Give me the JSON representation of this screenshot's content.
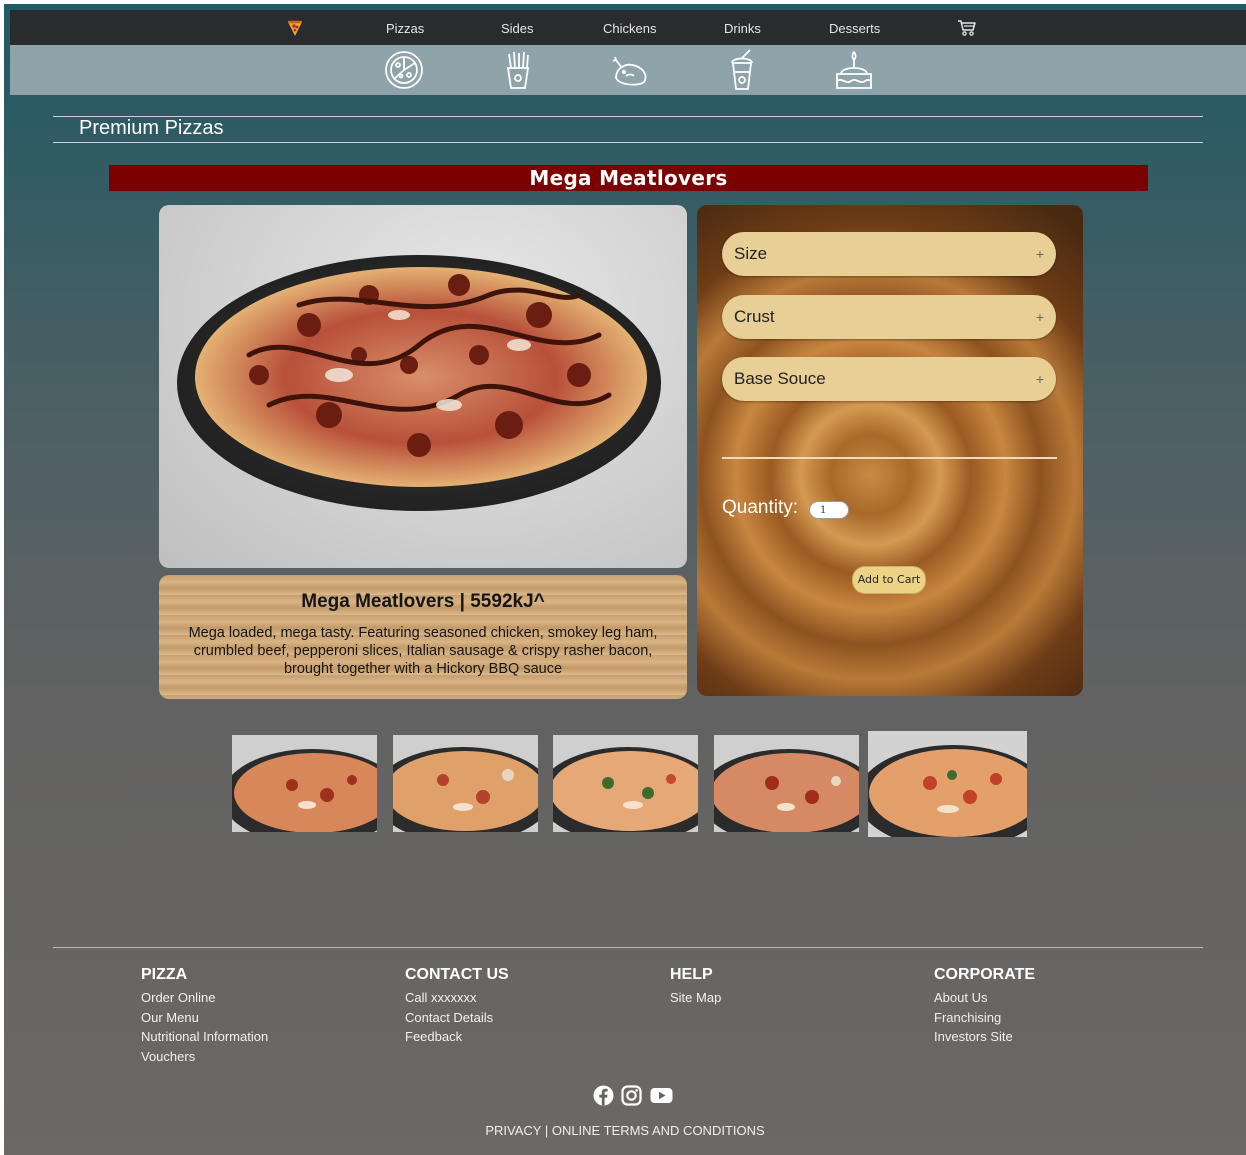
{
  "nav": {
    "items": [
      "Pizzas",
      "Sides",
      "Chickens",
      "Drinks",
      "Desserts"
    ],
    "logo_icon": "pizza-slice-icon",
    "cart_icon": "cart-icon"
  },
  "category_icons": [
    "pizza-icon",
    "fries-icon",
    "chicken-icon",
    "drink-icon",
    "cake-icon"
  ],
  "page": {
    "title": "Premium Pizzas"
  },
  "product": {
    "banner": "Mega Meatlovers",
    "title": "Mega Meatlovers | 5592kJ^",
    "description": "Mega loaded, mega tasty. Featuring seasoned chicken, smokey leg ham, crumbled beef, pepperoni slices, Italian sausage & crispy rasher bacon, brought together with a Hickory BBQ sauce"
  },
  "options": {
    "accordions": [
      "Size",
      "Crust",
      "Base Souce"
    ],
    "quantity_label": "Quantity:",
    "quantity_value": "1",
    "add_to_cart": "Add to Cart"
  },
  "thumbnails": {
    "count": 5,
    "selected_index": 4
  },
  "footer": {
    "columns": [
      {
        "heading": "PIZZA",
        "links": [
          "Order Online",
          "Our Menu",
          "Nutritional Information",
          "Vouchers"
        ]
      },
      {
        "heading": "CONTACT US",
        "links": [
          "Call xxxxxxx",
          "Contact Details",
          "Feedback"
        ]
      },
      {
        "heading": "HELP",
        "links": [
          "Site Map"
        ]
      },
      {
        "heading": "CORPORATE",
        "links": [
          "About Us",
          "Franchising",
          "Investors Site"
        ]
      }
    ],
    "social_icons": [
      "facebook-icon",
      "instagram-icon",
      "youtube-icon"
    ],
    "legal": {
      "privacy": "PRIVACY",
      "separator": "|",
      "terms": "ONLINE TERMS AND CONDITIONS"
    }
  },
  "colors": {
    "nav_bg": "#2a2b2d",
    "banner_red": "#7c0000",
    "accordion_bg": "#e8cf95",
    "cart_button": "#edd386"
  }
}
